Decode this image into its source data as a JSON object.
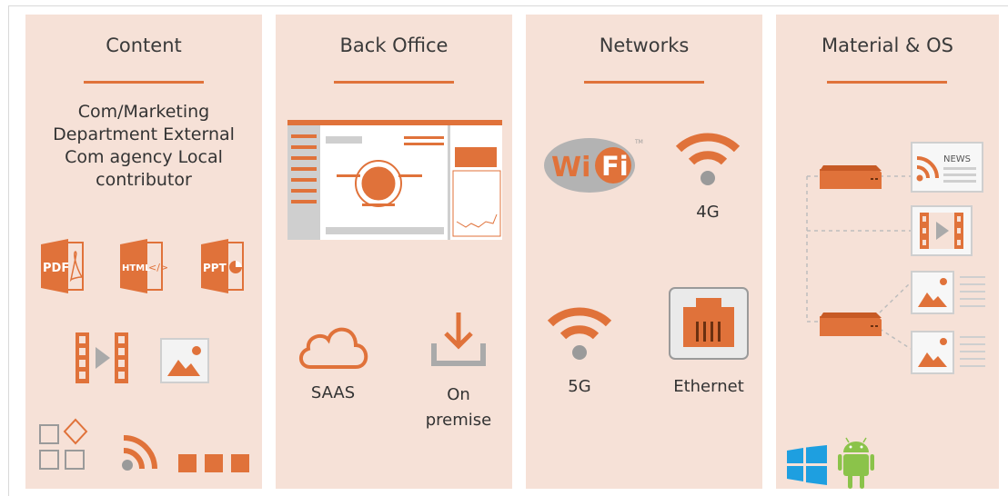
{
  "colors": {
    "accent": "#e0723a",
    "panel": "#f6e1d7",
    "grey": "#9a9a9a",
    "windows": "#1e9fe0",
    "android": "#8bc34a"
  },
  "columns": [
    {
      "title": "Content",
      "description": "Com/Marketing Department External Com agency Local contributor",
      "icons": [
        "pdf-icon",
        "html-icon",
        "ppt-icon",
        "video-icon",
        "image-icon",
        "widgets-icon",
        "rss-icon",
        "ticker-icon"
      ]
    },
    {
      "title": "Back Office",
      "items": [
        {
          "label": "SAAS",
          "icon": "cloud-icon"
        },
        {
          "label": "On premise",
          "icon": "download-icon"
        }
      ]
    },
    {
      "title": "Networks",
      "items": [
        {
          "label": "4G",
          "icon": "wifi-icon"
        },
        {
          "label": "5G",
          "icon": "wifi-icon"
        },
        {
          "label": "Ethernet",
          "icon": "ethernet-icon"
        }
      ],
      "wifi_logo": "Wi Fi"
    },
    {
      "title": "Material & OS",
      "news_label": "NEWS",
      "os": [
        "windows-icon",
        "android-icon"
      ]
    }
  ]
}
